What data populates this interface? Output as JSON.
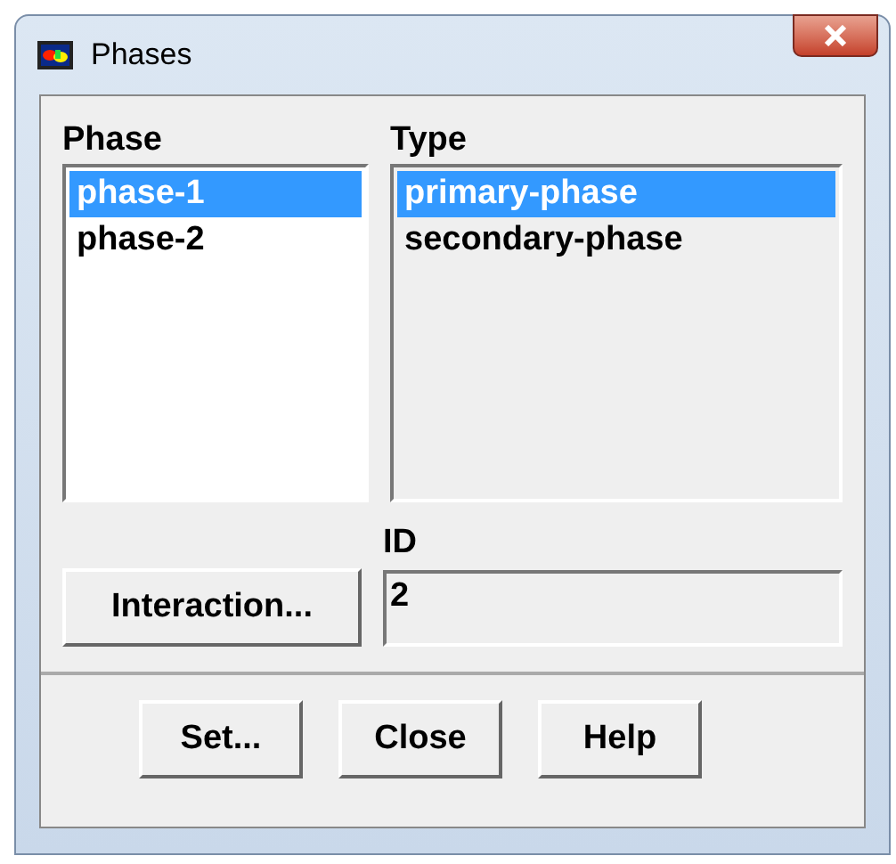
{
  "window": {
    "title": "Phases"
  },
  "phase_list": {
    "label": "Phase",
    "items": [
      {
        "text": "phase-1",
        "selected": true
      },
      {
        "text": "phase-2",
        "selected": false
      }
    ]
  },
  "type_list": {
    "label": "Type",
    "items": [
      {
        "text": "primary-phase",
        "selected": true
      },
      {
        "text": "secondary-phase",
        "selected": false
      }
    ]
  },
  "interaction_button": "Interaction...",
  "id_field": {
    "label": "ID",
    "value": "2"
  },
  "buttons": [
    "Set...",
    "Close",
    "Help"
  ]
}
